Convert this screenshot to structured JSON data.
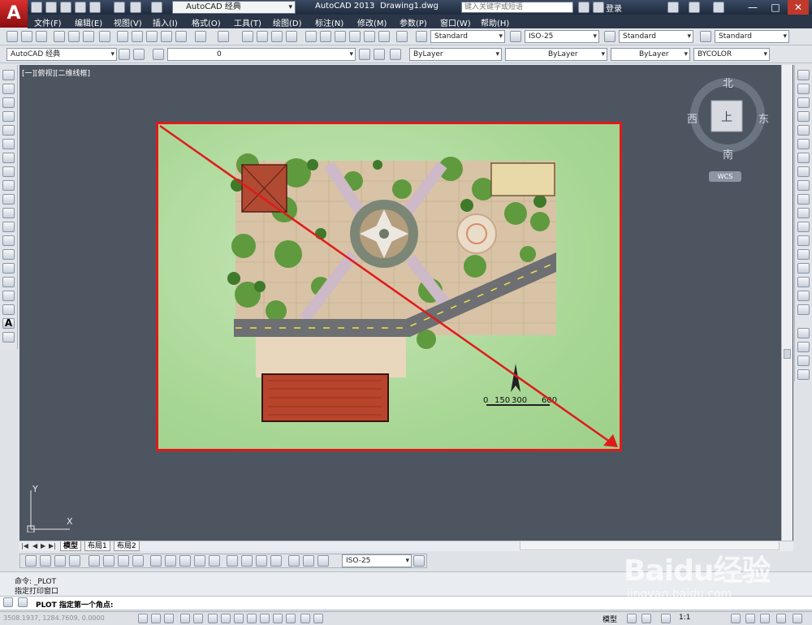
{
  "app": {
    "logo": "A",
    "title": "AutoCAD 2013",
    "file": "Drawing1.dwg"
  },
  "workspace": {
    "label": "AutoCAD 经典"
  },
  "search": {
    "placeholder": "键入关键字或短语"
  },
  "user": {
    "login_label": "登录"
  },
  "menu": [
    "文件(F)",
    "编辑(E)",
    "视图(V)",
    "插入(I)",
    "格式(O)",
    "工具(T)",
    "绘图(D)",
    "标注(N)",
    "修改(M)",
    "参数(P)",
    "窗口(W)",
    "帮助(H)"
  ],
  "toolbar": {
    "text_style": "Standard",
    "dim_style": "ISO-25",
    "table_style": "Standard",
    "multileader_style": "Standard",
    "workspace2": "AutoCAD 经典",
    "layer": "0",
    "color": "ByLayer",
    "linetype": "ByLayer",
    "lineweight": "ByLayer",
    "plotstyle": "BYCOLOR"
  },
  "viewport": {
    "label": "[一][俯视][二维线框]"
  },
  "viewcube": {
    "north": "北",
    "south": "南",
    "east": "东",
    "west": "西",
    "face": "上",
    "wcs": "WCS"
  },
  "ucs": {
    "x": "X",
    "y": "Y"
  },
  "scalebar": {
    "labels": [
      "0",
      "150",
      "300",
      "600"
    ]
  },
  "layout_tabs": [
    "模型",
    "布局1",
    "布局2"
  ],
  "dim_toolbar": {
    "style": "ISO-25"
  },
  "command": {
    "history": [
      "命令:  _PLOT",
      "指定打印窗口"
    ],
    "prompt": "PLOT 指定第一个角点:"
  },
  "status": {
    "coords": "3508.1937,  1284.7609,  0.0000",
    "model": "模型",
    "scale": "1:1"
  },
  "watermark": {
    "main": "Baidu经验",
    "sub": "jingyan.baidu.com"
  },
  "colors": {
    "frame": "#e01a1a",
    "canvas": "#4d5561",
    "title": "#1f2b3e"
  }
}
